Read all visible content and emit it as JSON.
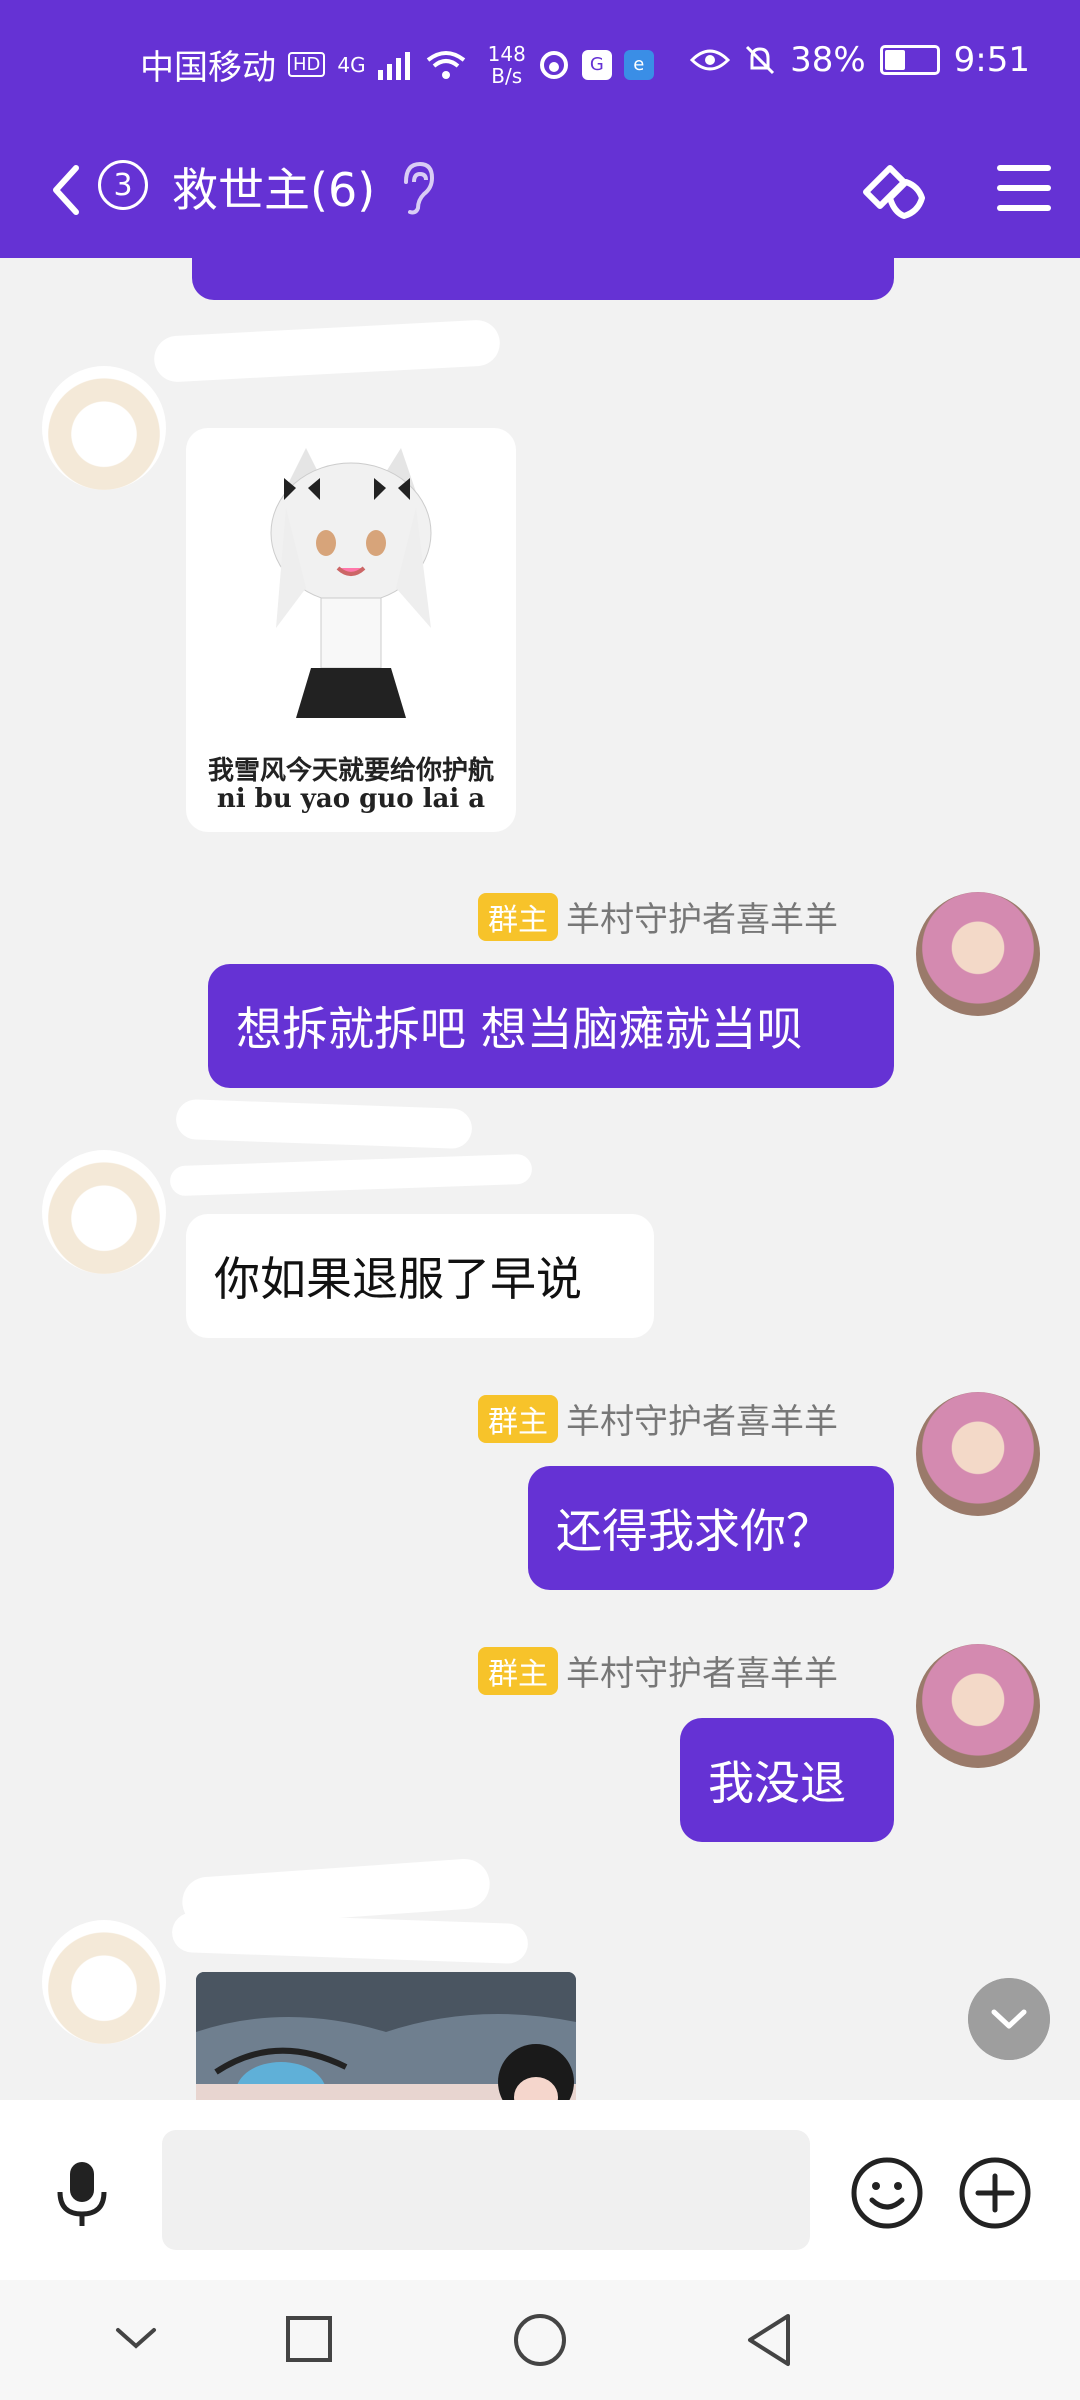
{
  "status_bar": {
    "carrier": "中国移动",
    "hd": "HD",
    "network": "4G",
    "speed_value": "148",
    "speed_unit": "B/s",
    "battery": "38%",
    "battery_level": 0.38,
    "time": "9:51"
  },
  "title_bar": {
    "unread_badge": "3",
    "title": "救世主(6)"
  },
  "messages": [
    {
      "sender": "them",
      "type": "sticker",
      "caption_line1": "我雪风今天就要给你护航",
      "caption_line2": "ni bu yao guo lai a"
    },
    {
      "sender": "me",
      "role": "群主",
      "name": "羊村守护者喜羊羊",
      "text": "想拆就拆吧 想当脑瘫就当呗"
    },
    {
      "sender": "them",
      "text": "你如果退服了早说"
    },
    {
      "sender": "me",
      "role": "群主",
      "name": "羊村守护者喜羊羊",
      "text": "还得我求你？"
    },
    {
      "sender": "me",
      "role": "群主",
      "name": "羊村守护者喜羊羊",
      "text": "我没退"
    },
    {
      "sender": "them",
      "type": "image"
    }
  ],
  "input_bar": {
    "placeholder": ""
  },
  "icons": [
    "back-icon",
    "ear-icon",
    "link-icon",
    "menu-icon",
    "mic-icon",
    "emoji-icon",
    "plus-icon",
    "chevron-down-icon",
    "square-icon",
    "circle-icon",
    "triangle-back-icon"
  ],
  "colors": {
    "accent": "#6532d4",
    "role_badge": "#f7c32a",
    "background": "#f2f2f2"
  }
}
